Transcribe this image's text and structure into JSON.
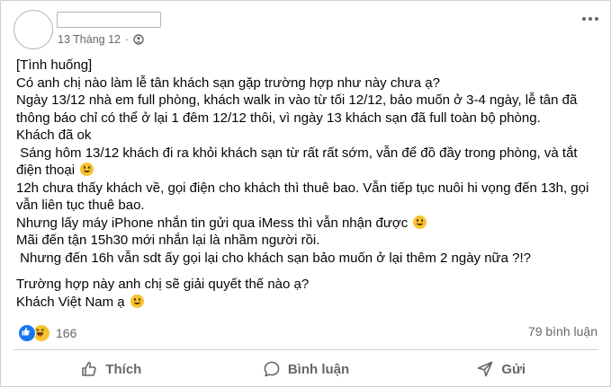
{
  "post": {
    "author_name": "",
    "date": "13 Tháng 12",
    "privacy_icon": "globe-icon",
    "menu_icon": "more-options-icon"
  },
  "content": {
    "lines": [
      "[Tình huống]",
      "Có anh chị nào làm lễ tân khách sạn gặp trường hợp như này chưa ạ?",
      "Ngày 13/12 nhà em full phòng, khách walk in vào từ tối 12/12, bảo muốn ở 3-4 ngày, lễ tân đã thông báo chỉ có thể ở lại 1 đêm 12/12 thôi, vì ngày 13 khách sạn đã full toàn bộ phòng.",
      "Khách đã ok",
      " Sáng hôm 13/12 khách đi ra khỏi khách sạn từ rất rất sớm, vẫn để đồ đầy trong phòng, và tắt điện thoại",
      "12h chưa thấy khách về, gọi điện cho khách thì thuê bao. Vẫn tiếp tục nuôi hi vọng đến 13h, gọi vẫn liên tục thuê bao.",
      "Nhưng lấy máy iPhone nhắn tin gửi qua iMess thì vẫn nhận được",
      "Mãi đến tận 15h30 mới nhắn lại là nhầm người rồi.",
      " Nhưng đến 16h vẫn sdt ấy gọi lại cho khách sạn bảo muốn ở lại thêm 2 ngày nữa ?!?",
      "Trường hợp này anh chị sẽ giải quyết thế nào ạ?",
      "Khách Việt Nam ạ"
    ]
  },
  "stats": {
    "reaction_count": "166",
    "comment_count": "79 bình luận",
    "reaction_icons": [
      "like-icon",
      "haha-icon"
    ]
  },
  "actions": {
    "like_label": "Thích",
    "comment_label": "Bình luận",
    "share_label": "Gửi"
  },
  "colors": {
    "accent": "#1877f2",
    "secondary_text": "#65676b",
    "emoji": "#f7c22d"
  }
}
